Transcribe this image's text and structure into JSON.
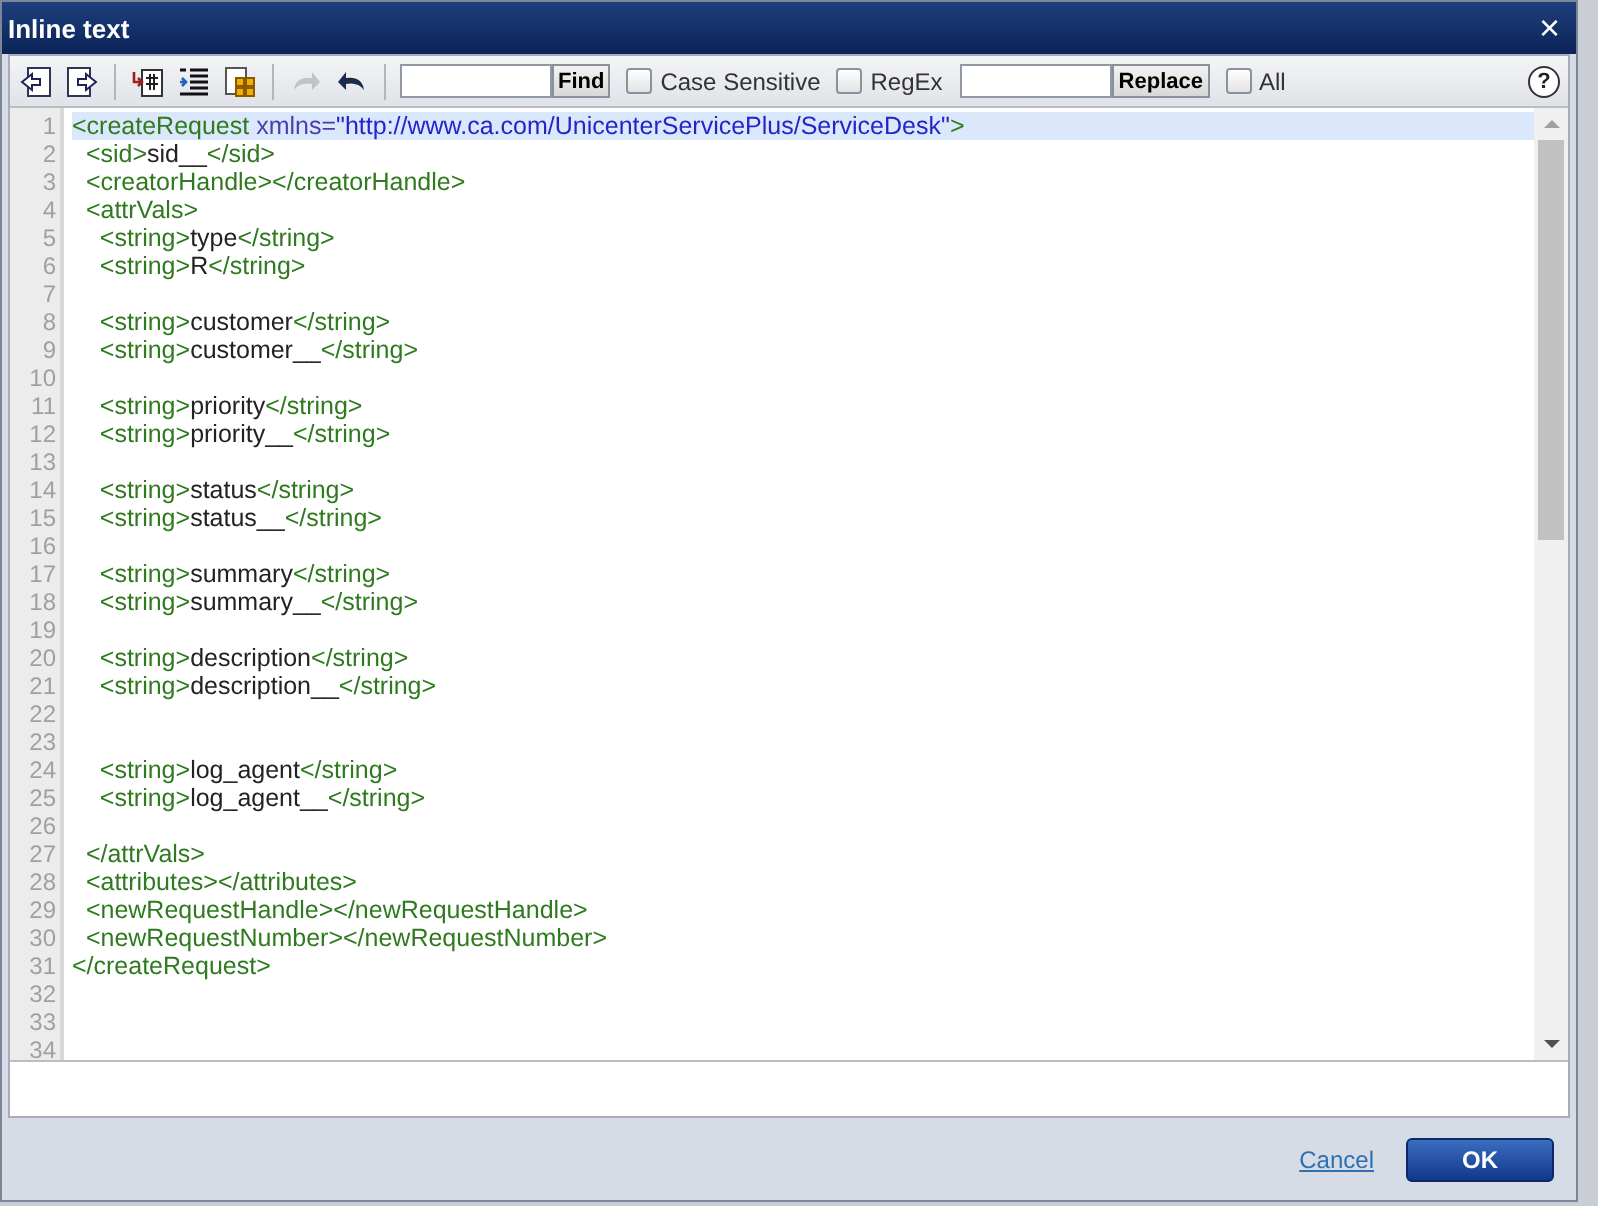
{
  "window": {
    "title": "Inline text",
    "close": "×"
  },
  "toolbar": {
    "buttons": [
      {
        "kind": "import",
        "disabled": false
      },
      {
        "kind": "export",
        "disabled": false
      },
      {
        "kind": "insert",
        "disabled": false
      },
      {
        "kind": "indent",
        "disabled": false
      },
      {
        "kind": "grid",
        "disabled": false
      },
      {
        "kind": "redo",
        "disabled": true
      },
      {
        "kind": "undo",
        "disabled": false
      }
    ],
    "find_button": "Find",
    "options": [
      {
        "label": "Case Sensitive",
        "checked": false
      },
      {
        "label": "RegEx",
        "checked": false
      }
    ],
    "replace_button": "Replace",
    "all": {
      "label": "All",
      "checked": false
    },
    "help": "?"
  },
  "editor": {
    "lines": [
      {
        "number": "1",
        "current": true,
        "segments": [
          {
            "kind": "tag",
            "text": "<createRequest"
          },
          {
            "kind": "attr",
            "text": " xmlns="
          },
          {
            "kind": "value",
            "text": "\"http://www.ca.com/UnicenterServicePlus/ServiceDesk\""
          },
          {
            "kind": "tag",
            "text": ">"
          }
        ]
      },
      {
        "number": "2",
        "current": false,
        "segments": [
          {
            "kind": "tag",
            "text": "  <sid>"
          },
          {
            "kind": "text",
            "text": "sid__"
          },
          {
            "kind": "tag",
            "text": "</sid>"
          }
        ]
      },
      {
        "number": "3",
        "current": false,
        "segments": [
          {
            "kind": "tag",
            "text": "  <creatorHandle></creatorHandle>"
          }
        ]
      },
      {
        "number": "4",
        "current": false,
        "segments": [
          {
            "kind": "tag",
            "text": "  <attrVals>"
          }
        ]
      },
      {
        "number": "5",
        "current": false,
        "segments": [
          {
            "kind": "tag",
            "text": "    <string>"
          },
          {
            "kind": "text",
            "text": "type"
          },
          {
            "kind": "tag",
            "text": "</string>"
          }
        ]
      },
      {
        "number": "6",
        "current": false,
        "segments": [
          {
            "kind": "tag",
            "text": "    <string>"
          },
          {
            "kind": "text",
            "text": "R"
          },
          {
            "kind": "tag",
            "text": "</string>"
          }
        ]
      },
      {
        "number": "7",
        "current": false
      },
      {
        "number": "8",
        "current": false,
        "segments": [
          {
            "kind": "tag",
            "text": "    <string>"
          },
          {
            "kind": "text",
            "text": "customer"
          },
          {
            "kind": "tag",
            "text": "</string>"
          }
        ]
      },
      {
        "number": "9",
        "current": false,
        "segments": [
          {
            "kind": "tag",
            "text": "    <string>"
          },
          {
            "kind": "text",
            "text": "customer__"
          },
          {
            "kind": "tag",
            "text": "</string>"
          }
        ]
      },
      {
        "number": "10",
        "current": false
      },
      {
        "number": "11",
        "current": false,
        "segments": [
          {
            "kind": "tag",
            "text": "    <string>"
          },
          {
            "kind": "text",
            "text": "priority"
          },
          {
            "kind": "tag",
            "text": "</string>"
          }
        ]
      },
      {
        "number": "12",
        "current": false,
        "segments": [
          {
            "kind": "tag",
            "text": "    <string>"
          },
          {
            "kind": "text",
            "text": "priority__"
          },
          {
            "kind": "tag",
            "text": "</string>"
          }
        ]
      },
      {
        "number": "13",
        "current": false
      },
      {
        "number": "14",
        "current": false,
        "segments": [
          {
            "kind": "tag",
            "text": "    <string>"
          },
          {
            "kind": "text",
            "text": "status"
          },
          {
            "kind": "tag",
            "text": "</string>"
          }
        ]
      },
      {
        "number": "15",
        "current": false,
        "segments": [
          {
            "kind": "tag",
            "text": "    <string>"
          },
          {
            "kind": "text",
            "text": "status__"
          },
          {
            "kind": "tag",
            "text": "</string>"
          }
        ]
      },
      {
        "number": "16",
        "current": false
      },
      {
        "number": "17",
        "current": false,
        "segments": [
          {
            "kind": "tag",
            "text": "    <string>"
          },
          {
            "kind": "text",
            "text": "summary"
          },
          {
            "kind": "tag",
            "text": "</string>"
          }
        ]
      },
      {
        "number": "18",
        "current": false,
        "segments": [
          {
            "kind": "tag",
            "text": "    <string>"
          },
          {
            "kind": "text",
            "text": "summary__"
          },
          {
            "kind": "tag",
            "text": "</string>"
          }
        ]
      },
      {
        "number": "19",
        "current": false
      },
      {
        "number": "20",
        "current": false,
        "segments": [
          {
            "kind": "tag",
            "text": "    <string>"
          },
          {
            "kind": "text",
            "text": "description"
          },
          {
            "kind": "tag",
            "text": "</string>"
          }
        ]
      },
      {
        "number": "21",
        "current": false,
        "segments": [
          {
            "kind": "tag",
            "text": "    <string>"
          },
          {
            "kind": "text",
            "text": "description__"
          },
          {
            "kind": "tag",
            "text": "</string>"
          }
        ]
      },
      {
        "number": "22",
        "current": false
      },
      {
        "number": "23",
        "current": false
      },
      {
        "number": "24",
        "current": false,
        "segments": [
          {
            "kind": "tag",
            "text": "    <string>"
          },
          {
            "kind": "text",
            "text": "log_agent"
          },
          {
            "kind": "tag",
            "text": "</string>"
          }
        ]
      },
      {
        "number": "25",
        "current": false,
        "segments": [
          {
            "kind": "tag",
            "text": "    <string>"
          },
          {
            "kind": "text",
            "text": "log_agent__"
          },
          {
            "kind": "tag",
            "text": "</string>"
          }
        ]
      },
      {
        "number": "26",
        "current": false
      },
      {
        "number": "27",
        "current": false,
        "segments": [
          {
            "kind": "tag",
            "text": "  </attrVals>"
          }
        ]
      },
      {
        "number": "28",
        "current": false,
        "segments": [
          {
            "kind": "tag",
            "text": "  <attributes></attributes>"
          }
        ]
      },
      {
        "number": "29",
        "current": false,
        "segments": [
          {
            "kind": "tag",
            "text": "  <newRequestHandle></newRequestHandle>"
          }
        ]
      },
      {
        "number": "30",
        "current": false,
        "segments": [
          {
            "kind": "tag",
            "text": "  <newRequestNumber></newRequestNumber>"
          }
        ]
      },
      {
        "number": "31",
        "current": false,
        "segments": [
          {
            "kind": "tag",
            "text": "</createRequest>"
          }
        ]
      },
      {
        "number": "32",
        "current": false
      },
      {
        "number": "33",
        "current": false
      },
      {
        "number": "34",
        "current": false
      }
    ]
  },
  "footer": {
    "cancel": "Cancel",
    "ok": "OK"
  }
}
